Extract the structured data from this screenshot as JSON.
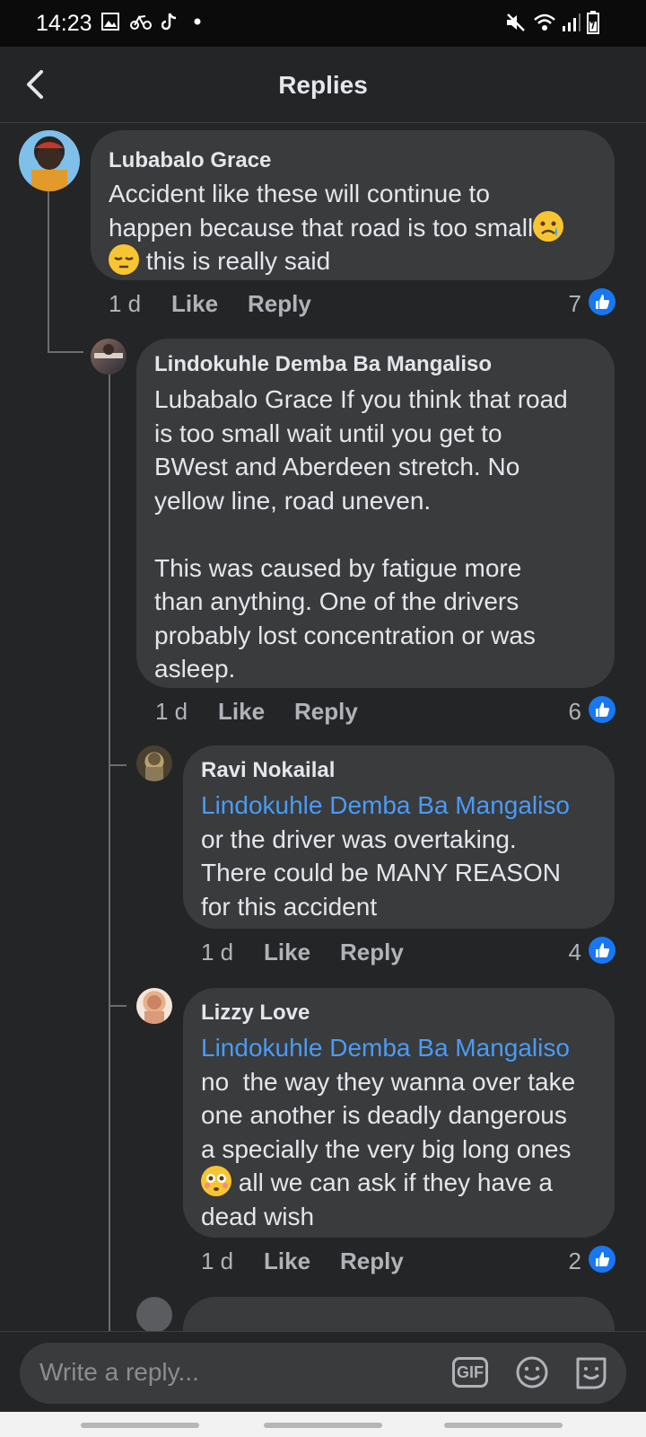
{
  "status_bar": {
    "time": "14:23",
    "icons": [
      "gallery-icon",
      "bike-icon",
      "tiktok-icon",
      "dot-icon",
      "mute-icon",
      "wifi-icon",
      "signal-icon",
      "battery-icon"
    ]
  },
  "header": {
    "title": "Replies",
    "back_icon": "chevron-left-icon"
  },
  "comments": [
    {
      "name": "Lubabalo Grace",
      "text_line1": "Accident like these will continue to",
      "text_line2": "happen because that road is too small",
      "text_line3": " this is really said",
      "emojis": [
        "crying-face-emoji",
        "pensive-face-emoji"
      ],
      "age": "1 d",
      "like_label": "Like",
      "reply_label": "Reply",
      "likes": "7"
    },
    {
      "name": "Lindokuhle Demba Ba Mangaliso",
      "text": "Lubabalo Grace If you think that road\nis too small wait until you get to\nBWest and Aberdeen stretch. No\nyellow line, road uneven.\n\nThis was caused by fatigue more\nthan anything. One of the drivers\nprobably lost concentration or was\nasleep.",
      "age": "1 d",
      "like_label": "Like",
      "reply_label": "Reply",
      "likes": "6"
    },
    {
      "name": "Ravi Nokailal",
      "mention": "Lindokuhle Demba Ba Mangaliso",
      "text": "or the driver was overtaking.\nThere could be MANY REASON\nfor this accident",
      "age": "1 d",
      "like_label": "Like",
      "reply_label": "Reply",
      "likes": "4"
    },
    {
      "name": "Lizzy Love",
      "mention": "Lindokuhle Demba Ba Mangaliso",
      "text_main": "no  the way they wanna over take\none another is deadly dangerous\na specially the very big long ones",
      "text_after_emoji": " all we can ask if they have a",
      "text_last": "dead wish",
      "emojis": [
        "flushed-face-emoji"
      ],
      "age": "1 d",
      "like_label": "Like",
      "reply_label": "Reply",
      "likes": "2"
    }
  ],
  "composer": {
    "placeholder": "Write a reply...",
    "gif_label": "GIF"
  },
  "colors": {
    "background": "#242526",
    "bubble": "#3a3b3c",
    "mention": "#4a9bf5",
    "like_badge": "#1877f2"
  }
}
